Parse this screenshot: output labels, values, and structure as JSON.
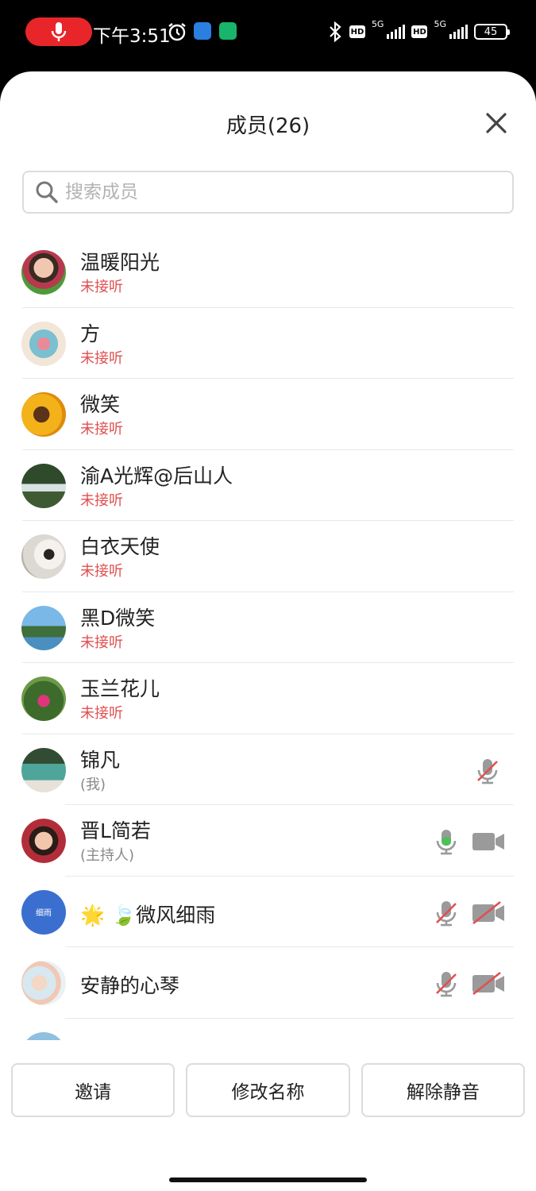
{
  "status": {
    "time": "下午3:51",
    "network": "5G",
    "battery": "45",
    "hd": "HD"
  },
  "title": "成员(26)",
  "search": {
    "placeholder": "搜索成员"
  },
  "members": [
    {
      "name": "温暖阳光",
      "sub": "未接听"
    },
    {
      "name": "方",
      "sub": "未接听"
    },
    {
      "name": "微笑",
      "sub": "未接听"
    },
    {
      "name": "渝A光辉@后山人",
      "sub": "未接听"
    },
    {
      "name": "白衣天使",
      "sub": "未接听"
    },
    {
      "name": "黑D微笑",
      "sub": "未接听"
    },
    {
      "name": "玉兰花儿",
      "sub": "未接听"
    },
    {
      "name": "锦凡",
      "sub": "(我)"
    },
    {
      "name": "晋L简若",
      "sub": "(主持人)"
    },
    {
      "name": "🌟 🍃微风细雨",
      "avatar_text": "细雨"
    },
    {
      "name": "安静的心琴"
    }
  ],
  "actions": {
    "invite": "邀请",
    "rename": "修改名称",
    "unmute": "解除静音"
  },
  "colors": {
    "missed_call": "#e05050",
    "mic_active": "#4cc15a",
    "record_pill": "#e8262a"
  }
}
